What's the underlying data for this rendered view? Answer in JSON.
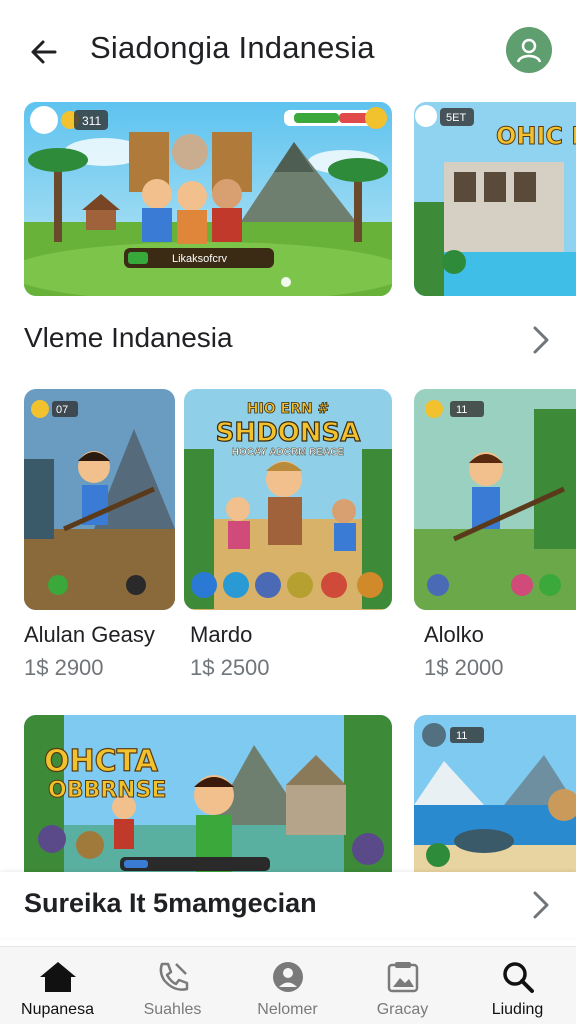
{
  "header": {
    "title": "Siadongia Indanesia",
    "back_icon": "arrow-left-icon",
    "profile_icon": "account-icon",
    "avatar_color": "#5f9e6e"
  },
  "featured": [
    {
      "badge_count": "311",
      "progress_label": "Likaksofcrv",
      "page": "2"
    },
    {
      "logo_text": "OHIC BIRL",
      "badge": "5ЕТ"
    }
  ],
  "section_1": {
    "title": "Vleme Indanesia"
  },
  "games": [
    {
      "name": "Alulan Geasy",
      "price": "1$ 2900",
      "badge": "07"
    },
    {
      "name": "Mardo",
      "price": "1$ 2500",
      "logo_text": "SHDONSA",
      "top_text": "HIO ERN #",
      "sub_text": "HOCAY ADCRM REACE"
    },
    {
      "name": "Alolko",
      "price": "1$ 2000",
      "badge": "11"
    }
  ],
  "banner_cards": [
    {
      "logo_text_1": "OHCTA",
      "logo_text_2": "OBBRNSE"
    },
    {
      "badge": "11"
    }
  ],
  "overlay": {
    "title": "Sureika It 5mamgecian"
  },
  "bottom_nav": {
    "items": [
      {
        "label": "Nupanesa",
        "icon": "home-icon",
        "active": true
      },
      {
        "label": "Suahles",
        "icon": "phone-icon",
        "active": false
      },
      {
        "label": "Nelomer",
        "icon": "user-circle-icon",
        "active": false
      },
      {
        "label": "Gracay",
        "icon": "gallery-icon",
        "active": false
      },
      {
        "label": "Liuding",
        "icon": "search-icon",
        "active": true
      }
    ]
  },
  "colors": {
    "accent_green": "#5f9e6e",
    "price_gray": "#70757a"
  }
}
